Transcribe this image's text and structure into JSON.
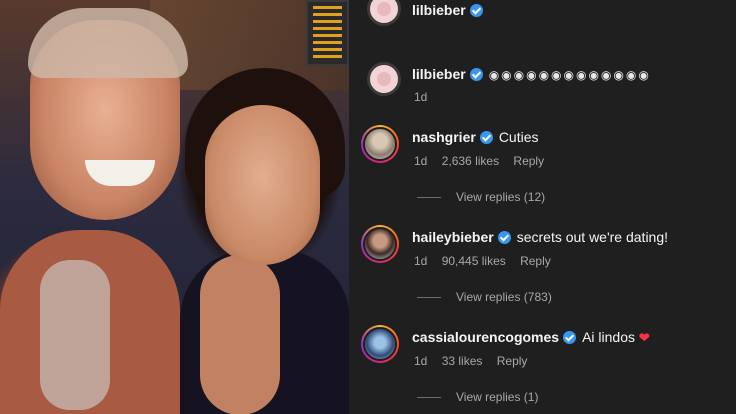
{
  "header": {
    "username": "lilbieber"
  },
  "comments": [
    {
      "username": "lilbieber",
      "text": "◉◉◉◉◉◉◉◉◉◉◉◉◉",
      "time": "1d"
    },
    {
      "username": "nashgrier",
      "text": "Cuties",
      "time": "1d",
      "likes": "2,636 likes",
      "reply_label": "Reply",
      "view_replies": "View replies (12)"
    },
    {
      "username": "haileybieber",
      "text": "secrets out we're dating!",
      "time": "1d",
      "likes": "90,445 likes",
      "reply_label": "Reply",
      "view_replies": "View replies (783)"
    },
    {
      "username": "cassialourencogomes",
      "text": "Ai lindos",
      "emoji": "❤",
      "time": "1d",
      "likes": "33 likes",
      "reply_label": "Reply",
      "view_replies": "View replies (1)"
    }
  ],
  "colors": {
    "background": "#1f1f1f",
    "verified": "#3797f0",
    "heart": "#ff3040",
    "muted": "#a8a8a8"
  },
  "icons": [
    "verified-badge-icon",
    "heart-emoji-icon"
  ]
}
